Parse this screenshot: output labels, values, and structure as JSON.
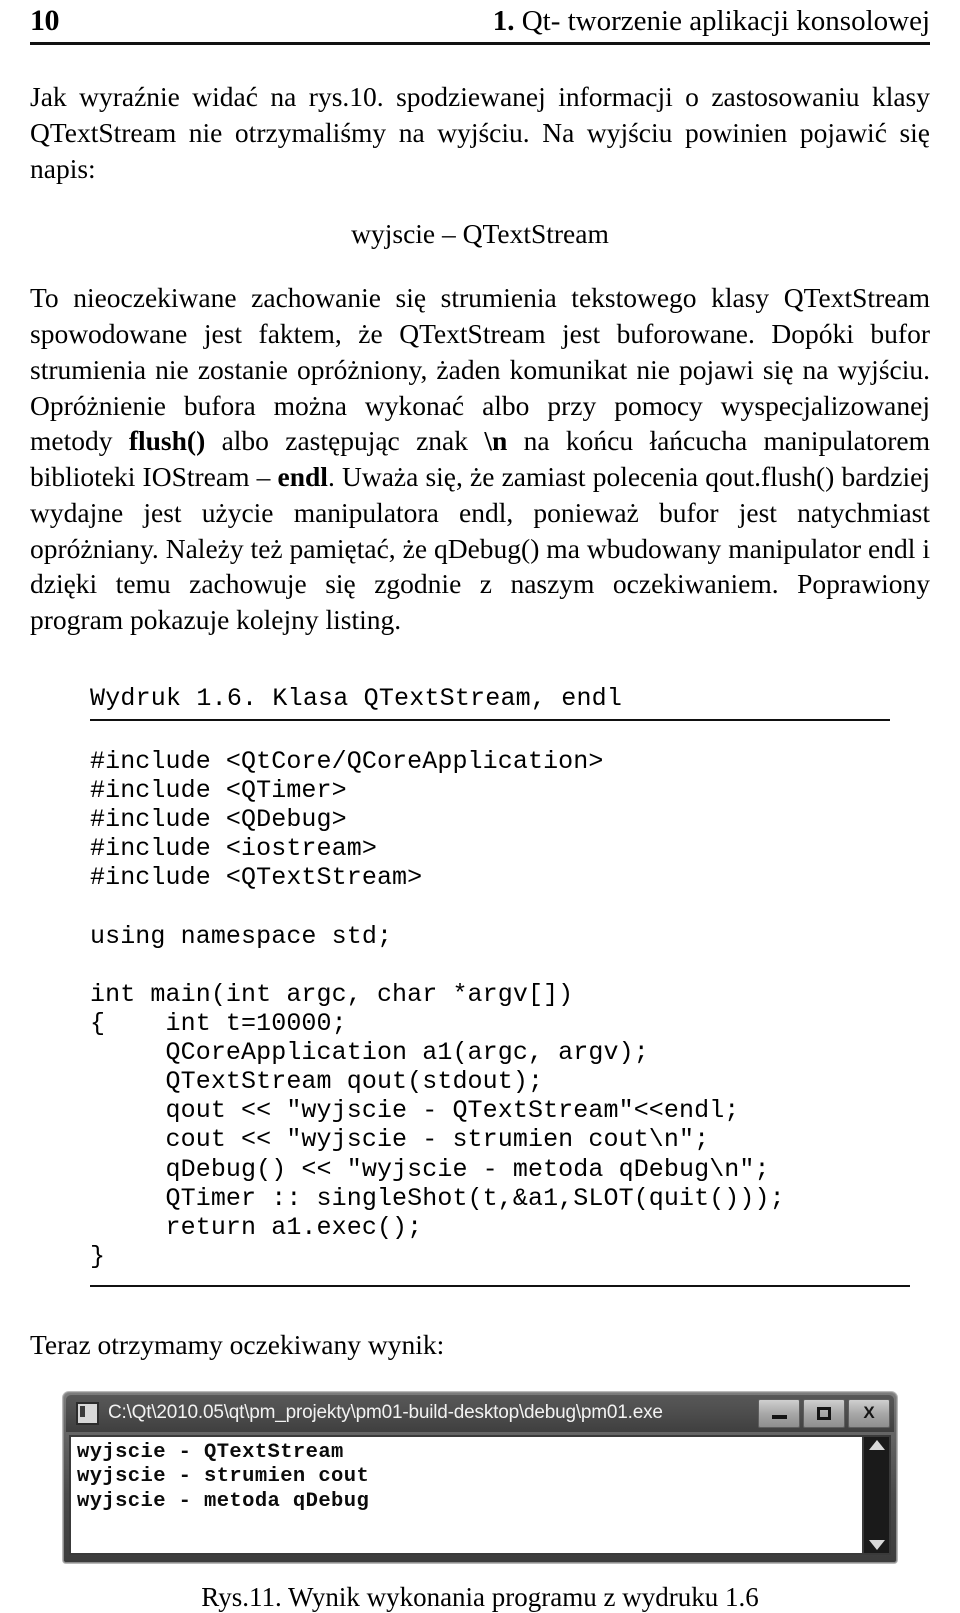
{
  "header": {
    "folio": "10",
    "chapter_number": "1.",
    "chapter_title": " Qt- tworzenie aplikacji konsolowej"
  },
  "body": {
    "paragraph_1_part_1": "Jak wyraźnie widać na rys.10. spodziewanej informacji o zastosowaniu klasy QTextStream nie otrzymaliśmy na wyjściu. ",
    "paragraph_1_part_2": "Na wyjściu powinien pojawić się napis:",
    "centered_output": "wyjscie – QTextStream",
    "paragraph_2_a": "To nieoczekiwane zachowanie się strumienia tekstowego klasy QTextStream spowodowane jest faktem, że QTextStream jest buforowane. Dopóki bufor strumienia nie zostanie opróżniony, żaden komunikat nie pojawi się na wyjściu. Opróżnienie bufora można wykonać albo przy pomocy wyspecjalizowanej metody ",
    "bold_flush": "flush()",
    "paragraph_2_b": " albo zastępując znak ",
    "bold_backslash_n": "\\n",
    "paragraph_2_c": " na końcu łańcucha manipulatorem biblioteki IOStream – ",
    "bold_endl": "endl",
    "paragraph_2_d": ". Uważa się, że zamiast polecenia qout.flush() bardziej wydajne jest użycie manipulatora endl, ponieważ bufor jest natychmiast opróżniany. Należy też pamiętać, że qDebug() ma wbudowany manipulator endl i dzięki temu zachowuje się zgodnie z naszym oczekiwaniem. Poprawiony program pokazuje kolejny listing.",
    "after_listing": "Teraz otrzymamy oczekiwany wynik:"
  },
  "listing": {
    "caption": "Wydruk 1.6. Klasa QTextStream, endl",
    "code": "#include <QtCore/QCoreApplication>\n#include <QTimer>\n#include <QDebug>\n#include <iostream>\n#include <QTextStream>\n\nusing namespace std;\n\nint main(int argc, char *argv[])\n{    int t=10000;\n     QCoreApplication a1(argc, argv);\n     QTextStream qout(stdout);\n     qout << \"wyjscie - QTextStream\"<<endl;\n     cout << \"wyjscie - strumien cout\\n\";\n     qDebug() << \"wyjscie - metoda qDebug\\n\";\n     QTimer :: singleShot(t,&a1,SLOT(quit()));\n     return a1.exec();\n}"
  },
  "console": {
    "title": "C:\\Qt\\2010.05\\qt\\pm_projekty\\pm01-build-desktop\\debug\\pm01.exe",
    "minimize_label": "minimize",
    "maximize_label": "maximize",
    "close_label": "X",
    "output": "wyjscie - QTextStream\nwyjscie - strumien cout\nwyjscie - metoda qDebug"
  },
  "figure": {
    "caption": "Rys.11. Wynik wykonania programu z wydruku 1.6"
  }
}
